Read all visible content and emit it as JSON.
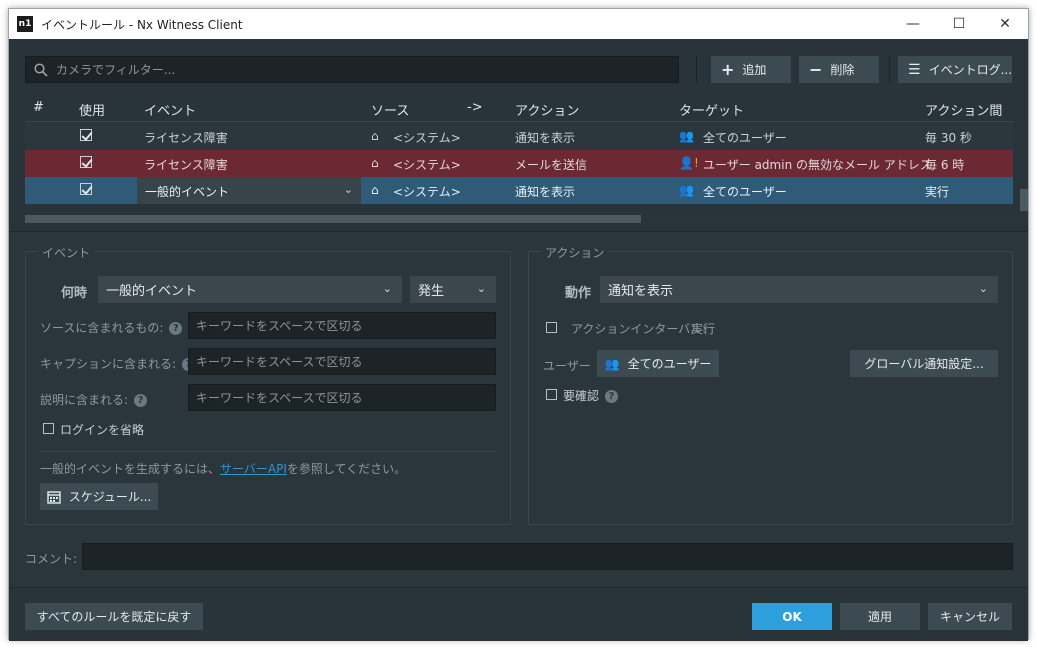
{
  "window": {
    "title": "イベントルール - Nx Witness Client",
    "logo": "n1",
    "minimize": "—",
    "maximize": "☐",
    "close": "✕"
  },
  "toolbar": {
    "search_placeholder": "カメラでフィルター...",
    "add_label": "追加",
    "delete_label": "削除",
    "log_label": "イベントログ..."
  },
  "table": {
    "headers": [
      "#",
      "使用",
      "イベント",
      "ソース",
      "->",
      "アクション",
      "ターゲット",
      "アクション間隔"
    ],
    "rows": [
      {
        "event": "ライセンス障害",
        "source": "<システム>",
        "action": "通知を表示",
        "target": "全てのユーザー",
        "interval": "毎 30 秒"
      },
      {
        "event": "ライセンス障害",
        "source": "<システム>",
        "action": "メールを送信",
        "target": "ユーザー admin の無効なメール アドレス",
        "interval": "毎 6 時"
      },
      {
        "event": "一般的イベント",
        "source": "<システム>",
        "action": "通知を表示",
        "target": "全てのユーザー",
        "interval": "実行"
      }
    ]
  },
  "event_panel": {
    "title": "イベント",
    "when_label": "何時",
    "when_value": "一般的イベント",
    "state_value": "発生",
    "source_label": "ソースに含まれるもの:",
    "caption_label": "キャプションに含まれる:",
    "desc_label": "説明に含まれる:",
    "keyword_placeholder": "キーワードをスペースで区切る",
    "omit_login": "ログインを省略",
    "api_text_before": "一般的イベントを生成するには、",
    "api_link": "サーバーAPI",
    "api_text_after": "を参照してください。",
    "schedule_label": "スケジュール..."
  },
  "action_panel": {
    "title": "アクション",
    "do_label": "動作",
    "do_value": "通知を表示",
    "interval_label": "アクションインターバル:",
    "interval_value": "実行",
    "user_label": "ユーザー",
    "users_value": "全てのユーザー",
    "global_btn": "グローバル通知設定...",
    "confirm_label": "要確認"
  },
  "comment_label": "コメント:",
  "footer": {
    "reset_label": "すべてのルールを既定に戻す",
    "ok_label": "OK",
    "apply_label": "適用",
    "cancel_label": "キャンセル"
  },
  "colors": {
    "error_row": "#6b2a33",
    "selected_row": "#2f5a78",
    "primary": "#2c9fdc"
  }
}
